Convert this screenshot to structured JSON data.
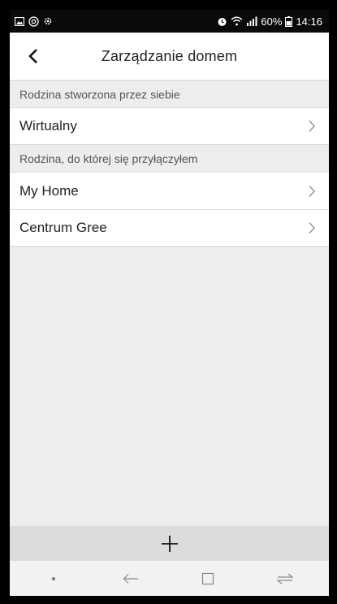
{
  "status_bar": {
    "battery_percent": "60%",
    "time": "14:16",
    "icons_left": [
      "gallery-icon",
      "at-icon",
      "settings-icon"
    ],
    "icons_right": [
      "alarm-icon",
      "wifi-icon",
      "signal-icon",
      "battery-icon"
    ]
  },
  "header": {
    "title": "Zarządzanie domem"
  },
  "sections": [
    {
      "header": "Rodzina stworzona przez siebie",
      "items": [
        {
          "label": "Wirtualny"
        }
      ]
    },
    {
      "header": "Rodzina, do której się przyłączyłem",
      "items": [
        {
          "label": "My Home"
        },
        {
          "label": "Centrum Gree"
        }
      ]
    }
  ],
  "bottom_action": {
    "icon": "plus-icon"
  },
  "nav_bar": {
    "icons": [
      "dot-icon",
      "back-arrow-icon",
      "recents-icon",
      "switch-icon"
    ]
  },
  "colors": {
    "status_bar_bg": "#0a0a0a",
    "page_bg": "#ededed",
    "add_bar_bg": "#dcdcdc"
  }
}
